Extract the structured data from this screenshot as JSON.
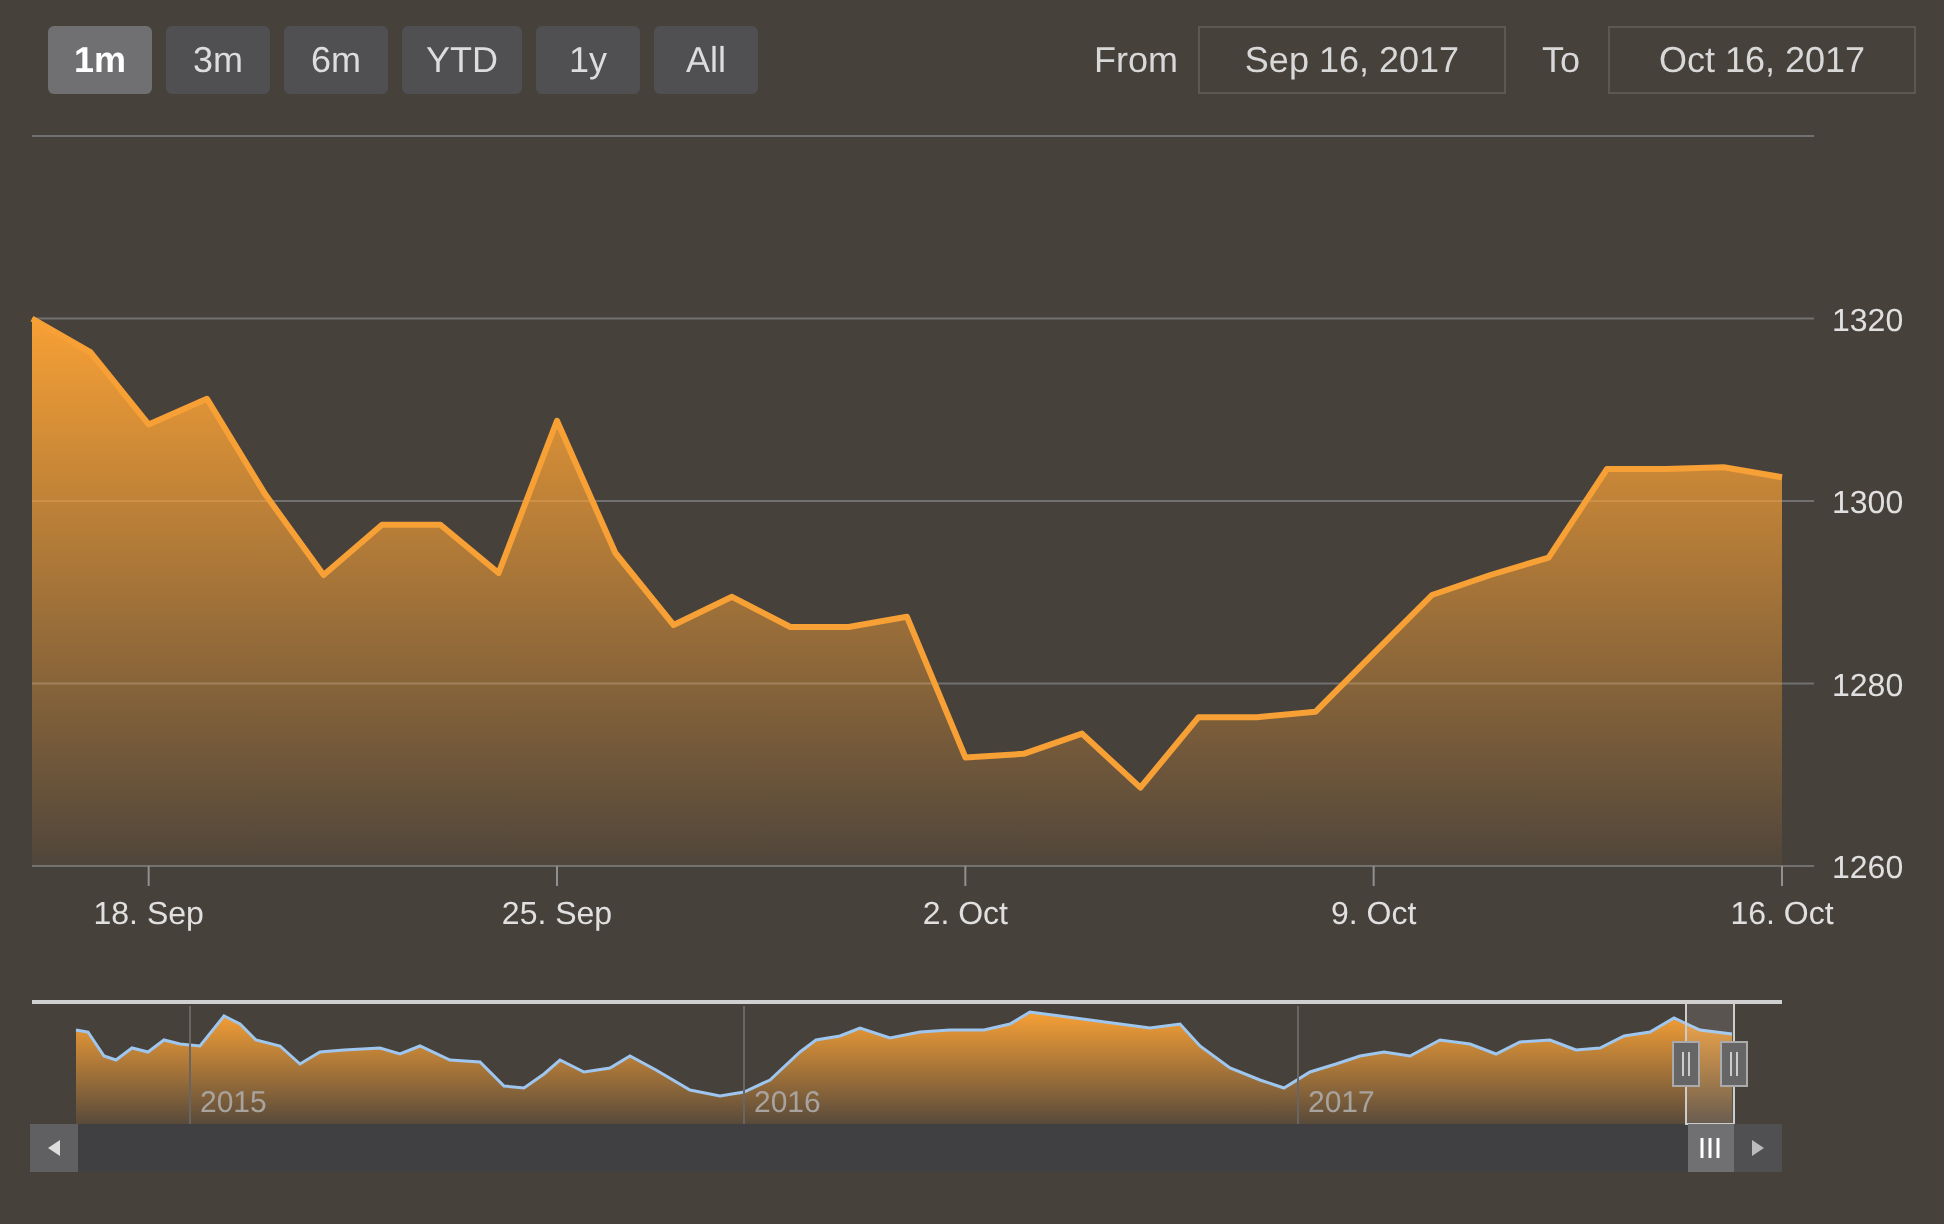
{
  "range_buttons": [
    {
      "label": "1m",
      "selected": true
    },
    {
      "label": "3m",
      "selected": false
    },
    {
      "label": "6m",
      "selected": false
    },
    {
      "label": "YTD",
      "selected": false
    },
    {
      "label": "1y",
      "selected": false
    },
    {
      "label": "All",
      "selected": false
    }
  ],
  "date_range": {
    "from_label": "From",
    "from_value": "Sep 16, 2017",
    "to_label": "To",
    "to_value": "Oct 16, 2017"
  },
  "chart": {
    "chart_data": {
      "type": "area",
      "grid": true,
      "categories": [
        null,
        null,
        "18. Sep",
        null,
        null,
        null,
        null,
        null,
        null,
        "25. Sep",
        null,
        null,
        null,
        null,
        null,
        null,
        "2. Oct",
        null,
        null,
        null,
        null,
        null,
        null,
        "9. Oct",
        null,
        null,
        null,
        null,
        null,
        null,
        "16. Oct"
      ],
      "ylim": [
        1260,
        1340
      ],
      "yticks": [
        1260,
        1280,
        1300,
        1320
      ],
      "series": [
        {
          "color": "#f7a035",
          "values": [
            1320,
            1316.3,
            1308.4,
            1311.2,
            1300.7,
            1291.9,
            1297.4,
            1297.4,
            1292.1,
            1308.8,
            1294.3,
            1286.4,
            1289.5,
            1286.2,
            1286.2,
            1287.3,
            1271.9,
            1272.3,
            1274.5,
            1268.6,
            1276.3,
            1276.3,
            1276.9,
            1283.3,
            1289.7,
            1291.9,
            1293.8,
            1303.5,
            1303.5,
            1303.7,
            1302.6
          ]
        }
      ]
    }
  },
  "navigator": {
    "year_labels": [
      "2015",
      "2016",
      "2017"
    ]
  }
}
